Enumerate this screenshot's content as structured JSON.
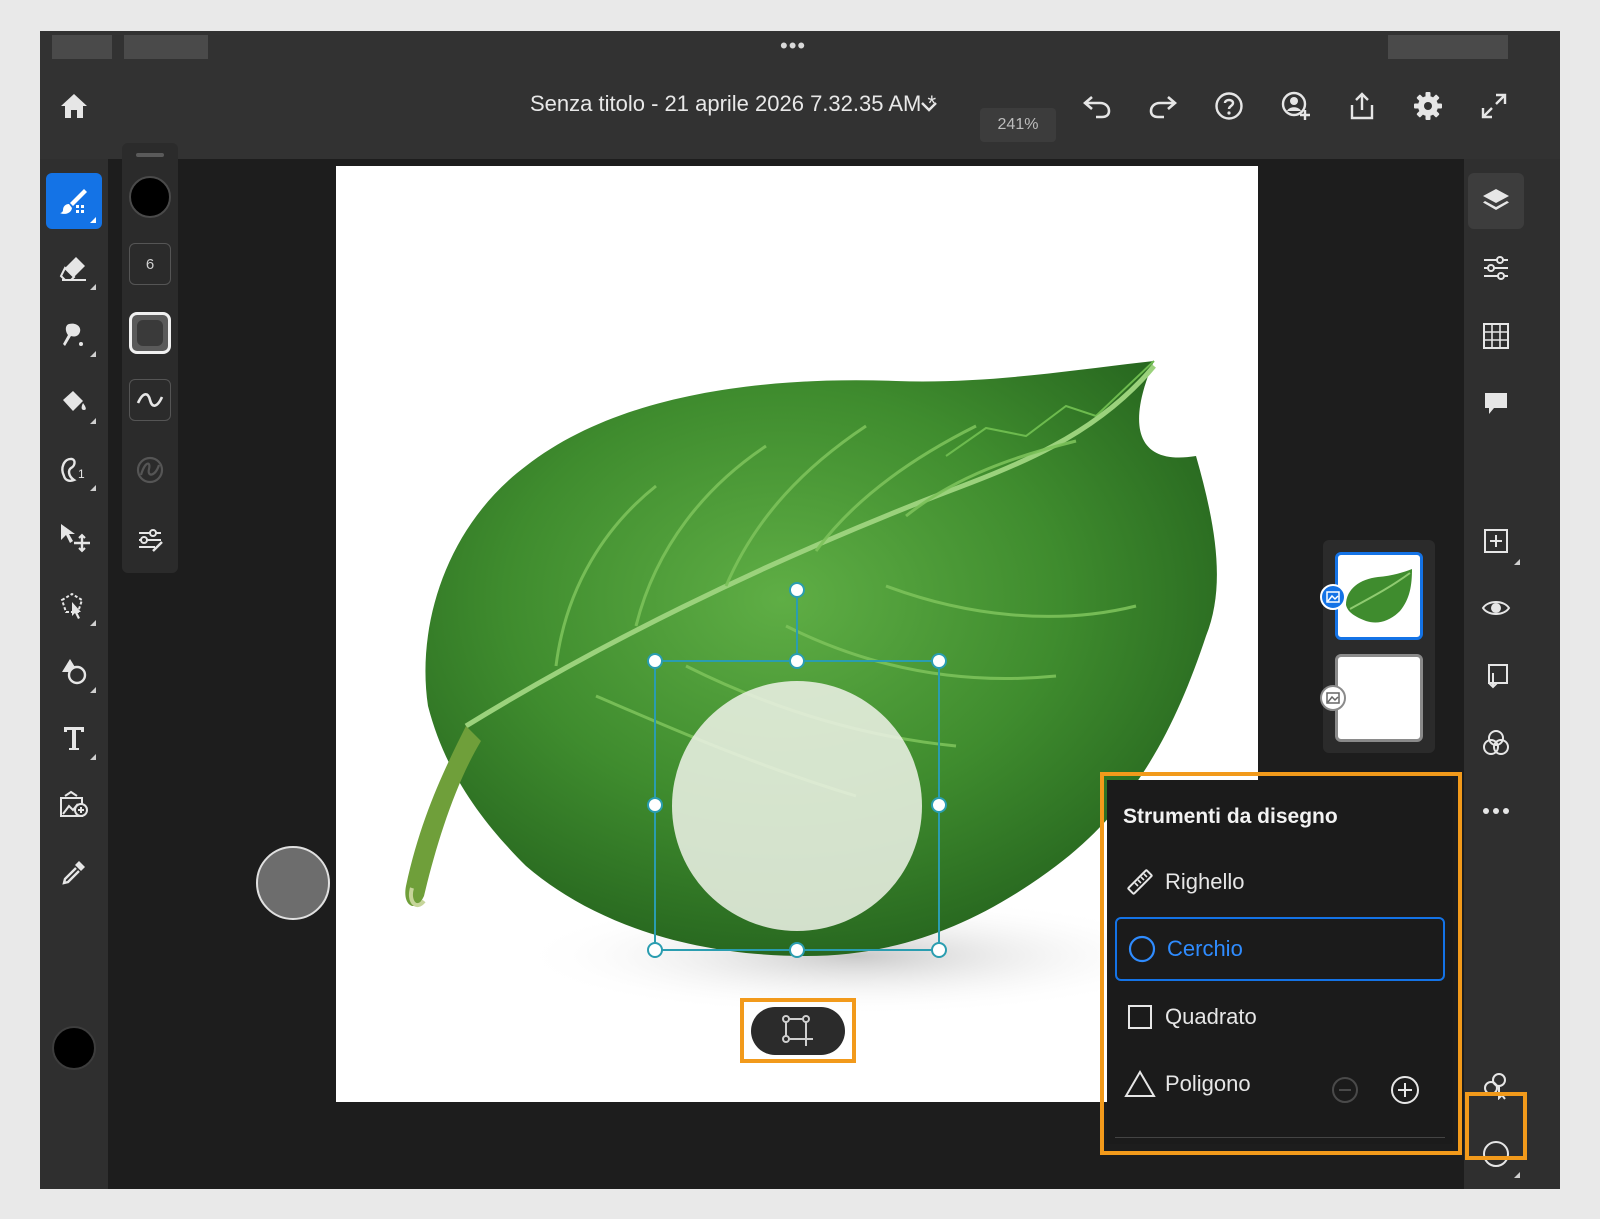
{
  "app": {
    "status_dots": "•••",
    "title": "Senza titolo - 21 aprile 2026 7.32.35 AM *",
    "zoom": "241%"
  },
  "icons": {
    "home": "home-icon",
    "chevron": "chevron-down-icon",
    "undo": "undo-icon",
    "redo": "redo-icon",
    "help": "help-icon",
    "share_user": "invite-user-icon",
    "export": "share-icon",
    "settings": "gear-icon",
    "fullscreen": "expand-icon"
  },
  "brush_options": {
    "size": "6"
  },
  "drawing_tools": {
    "title": "Strumenti da disegno",
    "items": [
      {
        "label": "Righello",
        "icon": "ruler-icon",
        "selected": false
      },
      {
        "label": "Cerchio",
        "icon": "circle-icon",
        "selected": true
      },
      {
        "label": "Quadrato",
        "icon": "square-icon",
        "selected": false
      },
      {
        "label": "Poligono",
        "icon": "triangle-icon",
        "selected": false
      }
    ]
  },
  "colors": {
    "accent": "#1473e6",
    "highlight": "#f29a1b",
    "foreground_color": "#000000"
  }
}
